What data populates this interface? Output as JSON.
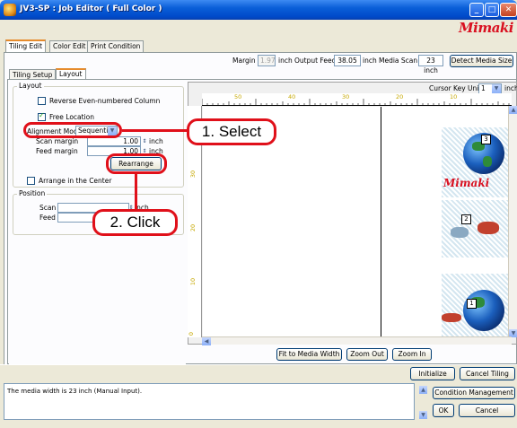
{
  "window": {
    "title": "JV3-SP : Job Editor ( Full Color )",
    "brand": "Mimaki"
  },
  "main_tabs": [
    {
      "label": "Tiling Edit",
      "active": true
    },
    {
      "label": "Color Edit",
      "active": false
    },
    {
      "label": "Print Condition",
      "active": false
    }
  ],
  "margin_bar": {
    "margin_label": "Margin",
    "margin_value": "1.97",
    "margin_unit": "inch",
    "output_feed_label": "Output Feed",
    "output_feed_value": "38.05",
    "output_feed_unit": "inch",
    "media_scan_label": "Media  Scan",
    "media_scan_value": "23 inch",
    "detect_button": "Detect Media Size"
  },
  "sub_tabs": [
    {
      "label": "Tiling Setup",
      "active": false
    },
    {
      "label": "Layout",
      "active": true
    }
  ],
  "layout_group": {
    "title": "Layout",
    "reverse_label": "Reverse Even-numbered Column",
    "reverse_checked": false,
    "free_location_label": "Free Location",
    "free_location_checked": true,
    "alignment_label": "Alignment Mode",
    "alignment_value": "Sequential",
    "scan_margin_label": "Scan margin",
    "scan_margin_value": "1.00",
    "feed_margin_label": "Feed margin",
    "feed_margin_value": "1.00",
    "unit": "inch",
    "rearrange_button": "Rearrange",
    "arrange_center_label": "Arrange in the Center",
    "arrange_center_checked": false
  },
  "position_group": {
    "title": "Position",
    "scan_label": "Scan",
    "feed_label": "Feed",
    "unit": "inch"
  },
  "preview": {
    "cursor_key_label": "Cursor Key Unit",
    "cursor_key_value": "1",
    "cursor_key_unit": "inch",
    "ruler_labels": [
      "50",
      "40",
      "30",
      "20",
      "10"
    ],
    "vruler_labels": [
      "30",
      "20",
      "10",
      "0"
    ],
    "tile_numbers": [
      "3",
      "2",
      "1"
    ],
    "tile_brand": "Mimaki"
  },
  "view_buttons": {
    "fit": "Fit to Media Width",
    "zoom_out": "Zoom Out",
    "zoom_in": "Zoom In"
  },
  "action_buttons": {
    "initialize": "Initialize",
    "cancel_tiling": "Cancel Tiling",
    "condition_management": "Condition Management",
    "ok": "OK",
    "cancel": "Cancel"
  },
  "status": {
    "message": "The media width is 23 inch (Manual Input)."
  },
  "callouts": {
    "select": "1. Select",
    "click": "2. Click"
  },
  "colors": {
    "accent_red": "#e0101a",
    "titlebar_blue": "#0a5fd8",
    "brand_red": "#d91020"
  }
}
